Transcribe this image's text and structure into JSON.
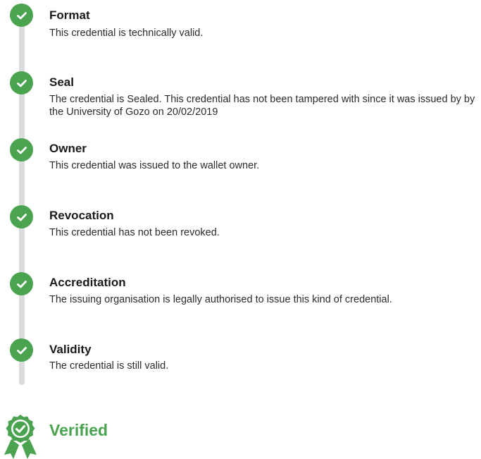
{
  "checks": [
    {
      "title": "Format",
      "description": "This credential is technically valid."
    },
    {
      "title": "Seal",
      "description": "The credential is Sealed. This credential has not been tampered with since it was issued by by the University of Gozo on 20/02/2019"
    },
    {
      "title": "Owner",
      "description": "This credential was issued to the wallet owner."
    },
    {
      "title": "Revocation",
      "description": "This credential has not been revoked."
    },
    {
      "title": "Accreditation",
      "description": "The issuing organisation is legally authorised to issue this kind of credential."
    },
    {
      "title": "Validity",
      "description": "The credential is still valid."
    }
  ],
  "result": {
    "label": "Verified",
    "icon": "award-badge-check-icon"
  },
  "colors": {
    "success": "#4aa34f",
    "track": "#dcdcdc"
  }
}
